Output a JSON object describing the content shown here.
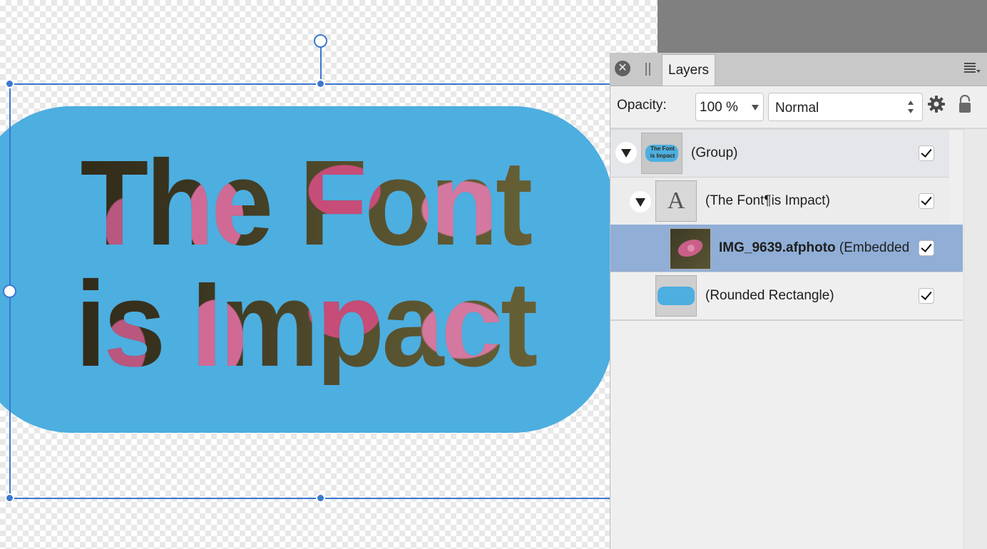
{
  "canvas": {
    "artwork_text_line1": "The Font",
    "artwork_text_line2": "is Impact",
    "shape_color": "#4daee0",
    "selection_color": "#3b78d0"
  },
  "panel": {
    "tab_label": "Layers",
    "opacity_label": "Opacity:",
    "opacity_value": "100 %",
    "blend_mode": "Normal"
  },
  "layers": [
    {
      "name": "(Group)",
      "thumb_text": "The Font is Impact",
      "visible": true,
      "expanded": true
    },
    {
      "name": "(The Font¶is Impact)",
      "thumb_glyph": "A",
      "visible": true,
      "expanded": true
    },
    {
      "name_bold": "IMG_9639.afphoto",
      "name_suffix": " (Embedded)",
      "visible": true,
      "selected": true
    },
    {
      "name": "(Rounded Rectangle)",
      "visible": true
    }
  ]
}
